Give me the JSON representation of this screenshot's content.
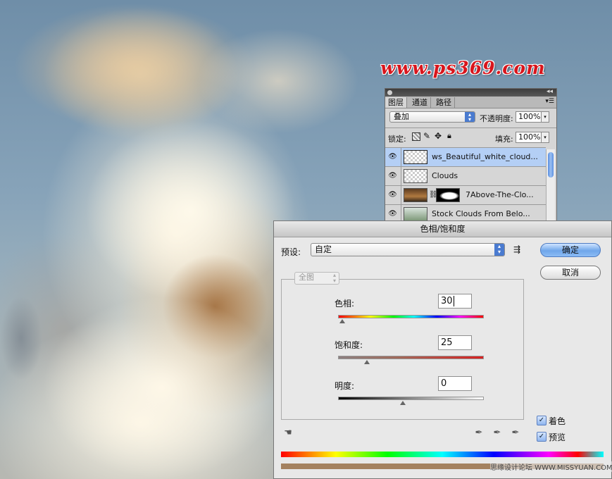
{
  "watermark": "www.ps369.com",
  "layers_panel": {
    "tabs": [
      "图层",
      "通道",
      "路径"
    ],
    "blend_mode": "叠加",
    "opacity_label": "不透明度:",
    "opacity_value": "100%",
    "lock_label": "锁定:",
    "fill_label": "填充:",
    "fill_value": "100%",
    "layers": [
      {
        "name": "ws_Beautiful_white_cloud..."
      },
      {
        "name": "Clouds"
      },
      {
        "name": "7Above-The-Clo..."
      },
      {
        "name": "Stock   Clouds  From  Belo..."
      }
    ]
  },
  "dialog": {
    "title": "色相/饱和度",
    "preset_label": "预设:",
    "preset_value": "自定",
    "ok_label": "确定",
    "cancel_label": "取消",
    "channel_value": "全图",
    "hue_label": "色相:",
    "hue_value": "30",
    "sat_label": "饱和度:",
    "sat_value": "25",
    "light_label": "明度:",
    "light_value": "0",
    "colorize_label": "着色",
    "preview_label": "预览",
    "credit": "思缘设计论坛  WWW.MISSYUAN.COM"
  },
  "colors": {
    "watermark": "#d8151c",
    "tinted_bar": "#a4815f",
    "selected_layer": "#b4cff5",
    "accent": "#4a7bd0"
  }
}
